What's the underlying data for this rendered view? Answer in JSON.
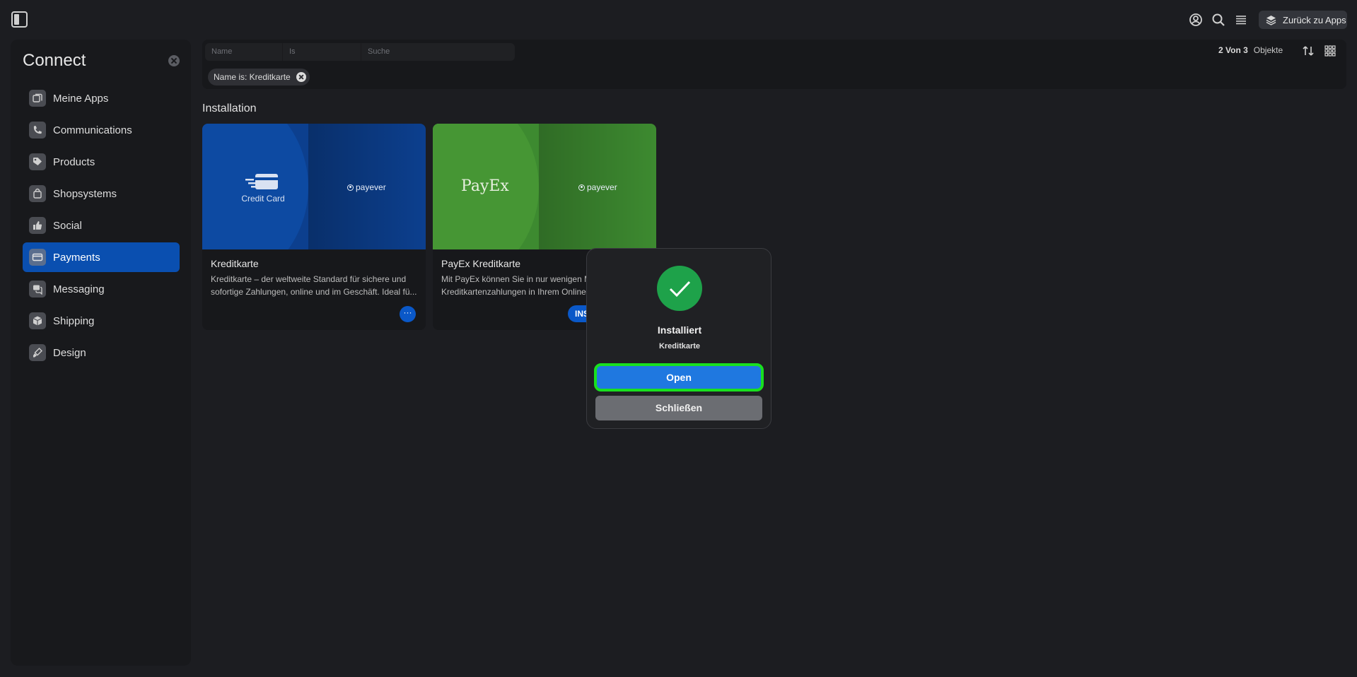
{
  "header": {
    "back_label": "Zurück zu Apps",
    "icons": [
      "sidebar-toggle-icon",
      "user-icon",
      "search-icon",
      "menu-icon",
      "layers-icon"
    ]
  },
  "sidebar": {
    "title": "Connect",
    "items": [
      {
        "label": "Meine Apps",
        "icon": "apps-icon",
        "active": false
      },
      {
        "label": "Communications",
        "icon": "phone-icon",
        "active": false
      },
      {
        "label": "Products",
        "icon": "tag-icon",
        "active": false
      },
      {
        "label": "Shopsystems",
        "icon": "shopping-bag-icon",
        "active": false
      },
      {
        "label": "Social",
        "icon": "thumbs-up-icon",
        "active": false
      },
      {
        "label": "Payments",
        "icon": "credit-card-icon",
        "active": true
      },
      {
        "label": "Messaging",
        "icon": "chat-icon",
        "active": false
      },
      {
        "label": "Shipping",
        "icon": "box-icon",
        "active": false
      },
      {
        "label": "Design",
        "icon": "brush-icon",
        "active": false
      }
    ]
  },
  "filter": {
    "name_placeholder": "Name",
    "is_placeholder": "Is",
    "search_placeholder": "Suche",
    "chip_label": "Name is: Kreditkarte",
    "count_value": "2 Von 3",
    "count_unit": "Objekte"
  },
  "main": {
    "section_title": "Installation",
    "cards": [
      {
        "title": "Kreditkarte",
        "description": "Kreditkarte – der weltweite Standard für sichere und sofortige Zahlungen, online und im Geschäft. Ideal fü...",
        "logo_text": "Credit Card",
        "brand": "payever",
        "action": "···"
      },
      {
        "title": "PayEx Kreditkarte",
        "description": "Mit PayEx können Sie in nur wenigen M Kreditkartenzahlungen in Ihrem Online",
        "logo_text": "PayEx",
        "brand": "payever",
        "action": "INS"
      }
    ]
  },
  "modal": {
    "title": "Installiert",
    "subtitle": "Kreditkarte",
    "primary_label": "Open",
    "secondary_label": "Schließen",
    "colors": {
      "success": "#1ea24a",
      "primary": "#1f78e0",
      "highlight": "#19e01f"
    }
  }
}
